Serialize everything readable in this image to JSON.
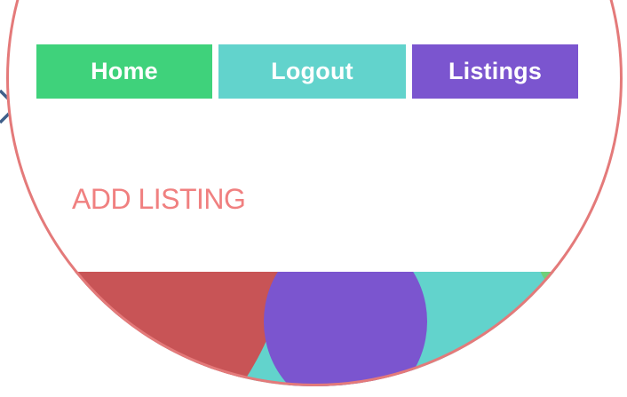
{
  "nav": {
    "items": [
      {
        "label": "Home",
        "color": "#3fd27b"
      },
      {
        "label": "Logout",
        "color": "#62d3cc"
      },
      {
        "label": "Listings",
        "color": "#7b55cf"
      }
    ]
  },
  "heading": {
    "text": "ADD LISTING",
    "color": "#f08080"
  },
  "colors": {
    "lens_border": "#e47a7a",
    "red_shape": "#c85456",
    "purple_shape": "#7b55cf",
    "teal_shape": "#62d3cc",
    "green_shape": "#6fcf7a",
    "pointer": "#3f5f8a"
  }
}
